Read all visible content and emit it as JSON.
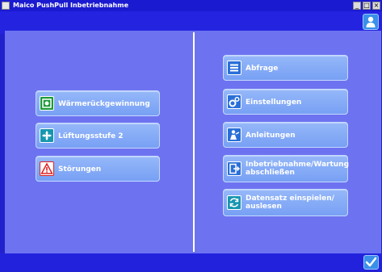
{
  "window": {
    "title": "Maico PushPull Inbetriebnahme",
    "controls": [
      "_",
      "□",
      "×"
    ]
  },
  "left_menu": [
    {
      "label": "Wärmerückgewinnung",
      "icon": "heat-recovery-icon"
    },
    {
      "label": "Lüftungsstufe 2",
      "icon": "fan-icon"
    },
    {
      "label": "Störungen",
      "icon": "warning-icon"
    }
  ],
  "right_menu": [
    {
      "label": "Abfrage",
      "icon": "list-icon"
    },
    {
      "label": "Einstellungen",
      "icon": "gears-icon"
    },
    {
      "label": "Anleitungen",
      "icon": "person-guide-icon"
    },
    {
      "label": "Inbetriebnahme/Wartung abschließen",
      "icon": "exit-door-icon"
    },
    {
      "label": "Datensatz einspielen/ auslesen",
      "icon": "sync-icon"
    }
  ],
  "colors": {
    "frame": "#2222cc",
    "panel": "#6d73f0",
    "button": "#8aaef7",
    "accent": "#3a8fe8"
  }
}
